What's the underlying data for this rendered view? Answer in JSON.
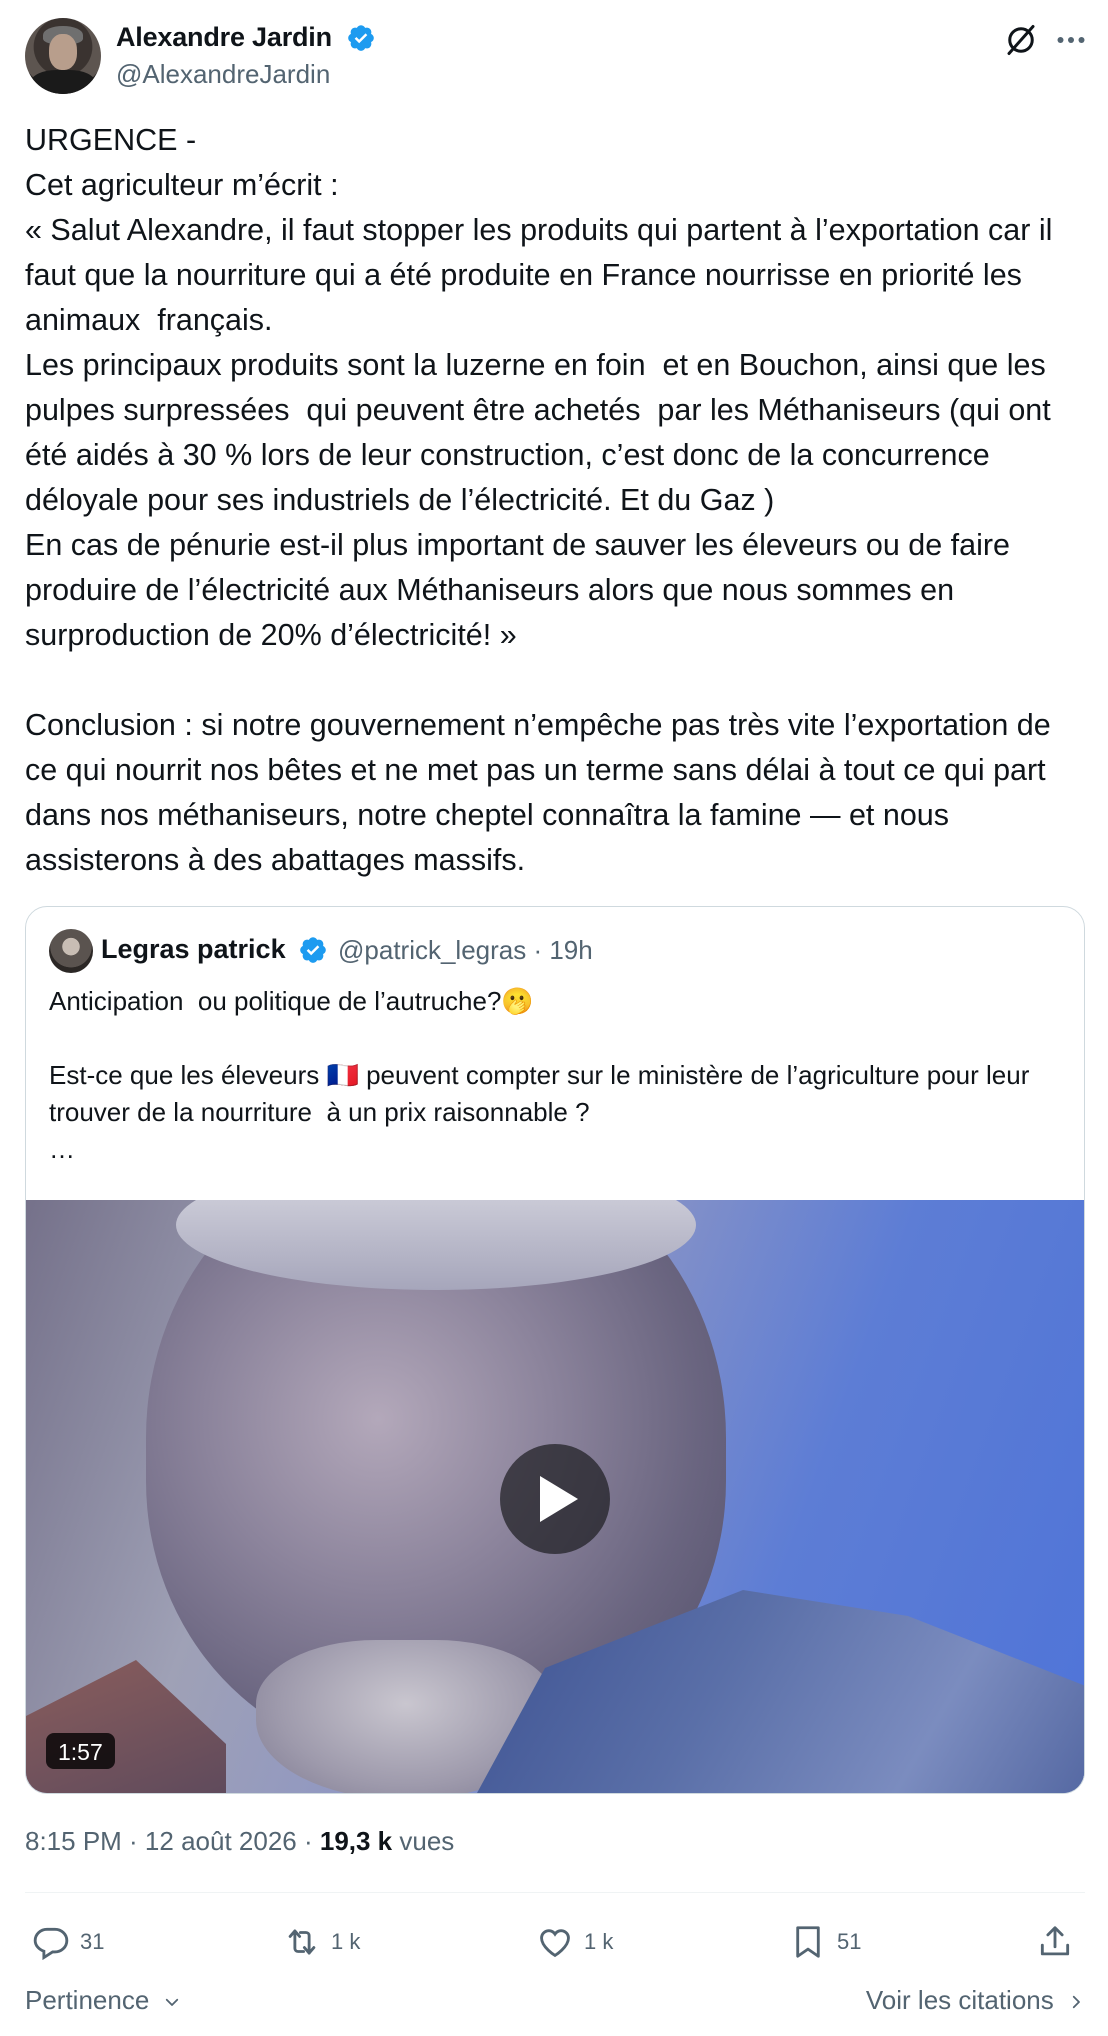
{
  "author": {
    "display_name": "Alexandre Jardin",
    "handle": "@AlexandreJardin",
    "verified_color": "#1d9bf0"
  },
  "tweet": {
    "text": "URGENCE -\nCet agriculteur m’écrit :\n« Salut Alexandre, il faut stopper les produits qui partent à l’exportation car il faut que la nourriture qui a été produite en France nourrisse en priorité les animaux  français.\nLes principaux produits sont la luzerne en foin  et en Bouchon, ainsi que les pulpes surpressées  qui peuvent être achetés  par les Méthaniseurs (qui ont été aidés à 30 % lors de leur construction, c’est donc de la concurrence déloyale pour ses industriels de l’électricité. Et du Gaz )\nEn cas de pénurie est-il plus important de sauver les éleveurs ou de faire produire de l’électricité aux Méthaniseurs alors que nous sommes en surproduction de 20% d’électricité! »\n\nConclusion : si notre gouvernement n’empêche pas très vite l’exportation de ce qui nourrit nos bêtes et ne met pas un terme sans délai à tout ce qui part dans nos méthaniseurs, notre cheptel connaîtra la famine — et nous assisterons à des abattages massifs."
  },
  "quote": {
    "display_name": "Legras patrick",
    "handle_time": "@patrick_legras · 19h",
    "text": "Anticipation  ou politique de l’autruche?🫢\n\nEst-ce que les éleveurs 🇫🇷 peuvent compter sur le ministère de l’agriculture pour leur trouver de la nourriture  à un prix raisonnable ?\n…",
    "video_duration": "1:57"
  },
  "meta": {
    "time_date": "8:15 PM · 12 août 2026 · ",
    "views_count": "19,3 k",
    "views_label": " vues"
  },
  "actions": {
    "reply_count": "31",
    "retweet_count": "1 k",
    "like_count": "1 k",
    "bookmark_count": "51"
  },
  "footer": {
    "sort_label": "Pertinence",
    "quotes_link": "Voir les citations"
  },
  "icons": [
    "grok-icon",
    "more-icon",
    "verified-badge-icon",
    "play-icon",
    "reply-icon",
    "retweet-icon",
    "like-icon",
    "bookmark-icon",
    "share-icon",
    "chevron-down-icon",
    "chevron-right-icon"
  ]
}
